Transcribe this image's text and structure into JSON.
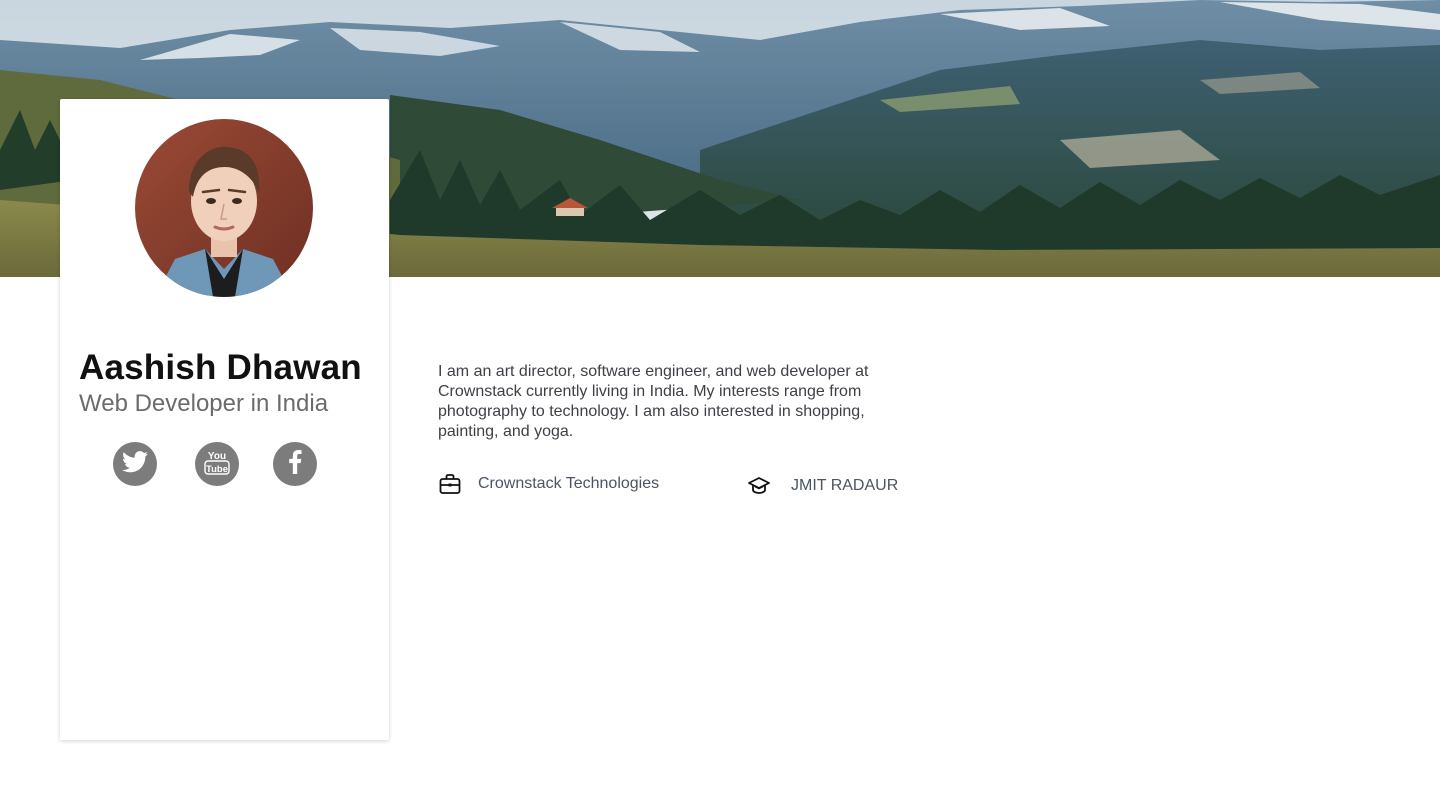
{
  "profile": {
    "name": "Aashish Dhawan",
    "role": "Web Developer in India",
    "bio": "I am an art director, software engineer, and web developer at Crownstack currently living in India. My interests range from photography to technology. I am also interested in shopping, painting, and yoga.",
    "company": "Crownstack Technologies",
    "education": "JMIT RADAUR"
  },
  "social": [
    {
      "icon": "twitter-icon",
      "label": "Twitter"
    },
    {
      "icon": "youtube-icon",
      "label": "YouTube"
    },
    {
      "icon": "facebook-icon",
      "label": "Facebook"
    }
  ],
  "icons": {
    "company": "briefcase-icon",
    "education": "graduation-cap-icon"
  },
  "colors": {
    "social_bg": "#7c7c7c",
    "name": "#111111",
    "role": "#6b6b6b",
    "body_text": "#3f3f46"
  }
}
